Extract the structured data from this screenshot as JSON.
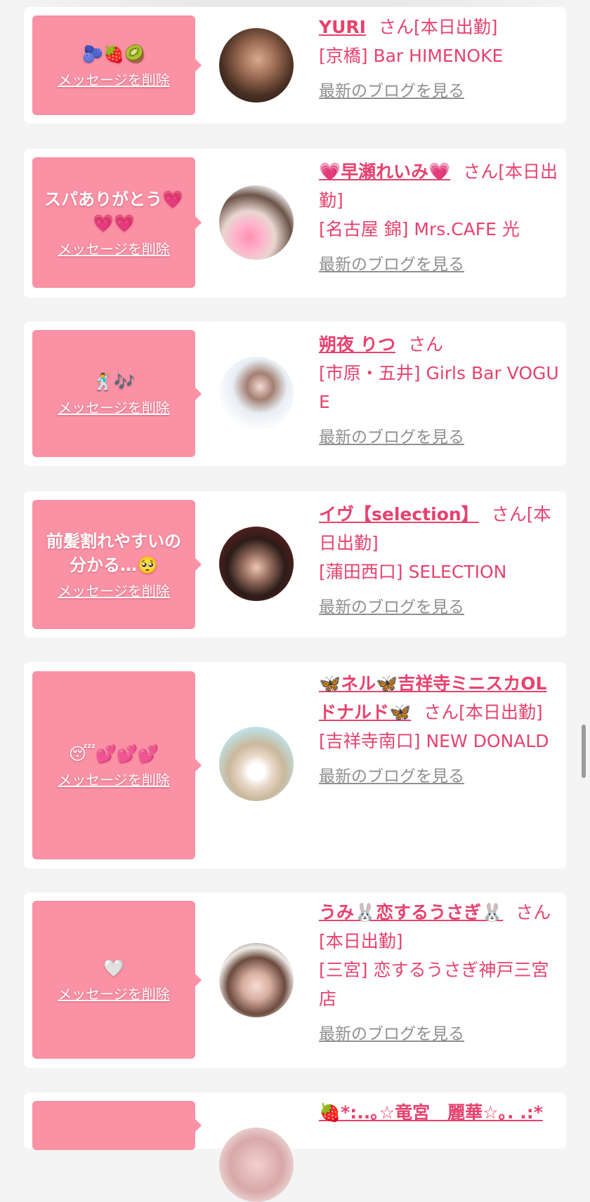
{
  "delete_label": "メッセージを削除",
  "blog_label": "最新のブログを見る",
  "san": "さん",
  "cards": [
    {
      "message": "🫐🍓🥝",
      "name": "YURI",
      "suffix": "[本日出勤]",
      "shop": "[京橋] Bar HIMENOKE"
    },
    {
      "message": "スパありがとう💗💗💗",
      "name": "💗早瀬れいみ💗",
      "suffix": "[本日出勤]",
      "shop": "[名古屋 錦] Mrs.CAFE 光"
    },
    {
      "message": "🕺🎶",
      "name": "朔夜 りつ",
      "suffix": "",
      "shop": "[市原・五井] Girls Bar VOGUE"
    },
    {
      "message": "前髪割れやすいの分かる…🥺",
      "name": "イヴ【selection】",
      "suffix": "[本日出勤]",
      "shop": "[蒲田西口] SELECTION"
    },
    {
      "message": "😴💕💕💕",
      "name": "🦋ネル🦋吉祥寺ミニスカOLドナルド🦋",
      "suffix": "[本日出勤]",
      "shop": "[吉祥寺南口] NEW DONALD"
    },
    {
      "message": "🤍",
      "name": "うみ🐰恋するうさぎ🐰",
      "suffix": "[本日出勤]",
      "shop": "[三宮] 恋するうさぎ神戸三宮店"
    },
    {
      "message": "",
      "name": "🍓*:..｡☆竜宮　麗華☆｡. .:*",
      "suffix": "",
      "shop": ""
    }
  ]
}
